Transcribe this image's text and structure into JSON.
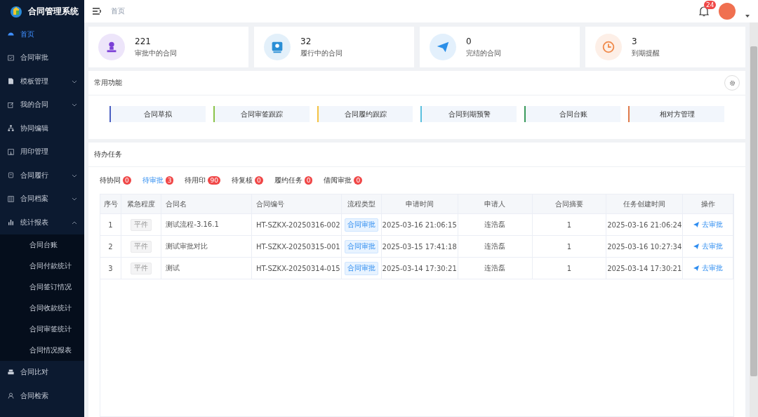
{
  "sidebar": {
    "title": "合同管理系统",
    "items": [
      {
        "label": "首页",
        "selected": true
      },
      {
        "label": "合同审批",
        "selected": false
      },
      {
        "label": "模板管理",
        "selected": false,
        "expanded": false
      },
      {
        "label": "我的合同",
        "selected": false,
        "expanded": false
      },
      {
        "label": "协同编辑",
        "selected": false
      },
      {
        "label": "用印管理",
        "selected": false
      },
      {
        "label": "合同履行",
        "selected": false,
        "expanded": false
      },
      {
        "label": "合同档案",
        "selected": false,
        "expanded": false
      },
      {
        "label": "统计报表",
        "selected": false,
        "expanded": true,
        "children": [
          {
            "label": "合同台账",
            "selected": false
          },
          {
            "label": "合同付款统计",
            "selected": false
          },
          {
            "label": "合同签订情况",
            "selected": false
          },
          {
            "label": "合同收款统计",
            "selected": false
          },
          {
            "label": "合同审签统计",
            "selected": false
          },
          {
            "label": "合同情况报表",
            "selected": false
          }
        ]
      },
      {
        "label": "合同比对",
        "selected": false
      },
      {
        "label": "合同检索",
        "selected": false
      }
    ]
  },
  "header": {
    "breadcrumb": "首页",
    "notifications": "24"
  },
  "stats": [
    {
      "value": "221",
      "label": "审批中的合同",
      "color": "#7b3fd6"
    },
    {
      "value": "32",
      "label": "履行中的合同",
      "color": "#2b8fd6"
    },
    {
      "value": "0",
      "label": "完结的合同",
      "color": "#2b8fe8"
    },
    {
      "value": "3",
      "label": "到期提醒",
      "color": "#f08a4b"
    }
  ],
  "shortcuts": {
    "title": "常用功能",
    "items": [
      {
        "label": "合同草拟",
        "color": "#4a5fc1"
      },
      {
        "label": "合同审签跟踪",
        "color": "#8bc34a"
      },
      {
        "label": "合同履约跟踪",
        "color": "#f5c242"
      },
      {
        "label": "合同到期预警",
        "color": "#5bc0de"
      },
      {
        "label": "合同台账",
        "color": "#3a9a5b"
      },
      {
        "label": "相对方管理",
        "color": "#e07a4a"
      }
    ]
  },
  "tasks": {
    "title": "待办任务",
    "tabs": [
      {
        "label": "待协同",
        "count": "0",
        "selected": false
      },
      {
        "label": "待审批",
        "count": "3",
        "selected": true
      },
      {
        "label": "待用印",
        "count": "90",
        "selected": false
      },
      {
        "label": "待复核",
        "count": "0",
        "selected": false
      },
      {
        "label": "履约任务",
        "count": "0",
        "selected": false
      },
      {
        "label": "借阅审批",
        "count": "0",
        "selected": false
      }
    ],
    "table": {
      "columns": [
        "序号",
        "紧急程度",
        "合同名",
        "合同编号",
        "流程类型",
        "申请时间",
        "申请人",
        "合同摘要",
        "任务创建时间",
        "操作"
      ],
      "rows": [
        [
          "1",
          "平件",
          "测试流程-3.16.1",
          "HT-SZKX-20250316-002",
          "合同审批",
          "2025-03-16 21:06:15",
          "连浩磊",
          "1",
          "2025-03-16 21:06:24",
          "去审批"
        ],
        [
          "2",
          "平件",
          "测试审批对比",
          "HT-SZKX-20250315-001",
          "合同审批",
          "2025-03-15 17:41:18",
          "连浩磊",
          "1",
          "2025-03-16 10:27:34",
          "去审批"
        ],
        [
          "3",
          "平件",
          "测试",
          "HT-SZKX-20250314-015",
          "合同审批",
          "2025-03-14 17:30:21",
          "连浩磊",
          "1",
          "2025-03-14 17:30:21",
          "去审批"
        ]
      ]
    }
  }
}
